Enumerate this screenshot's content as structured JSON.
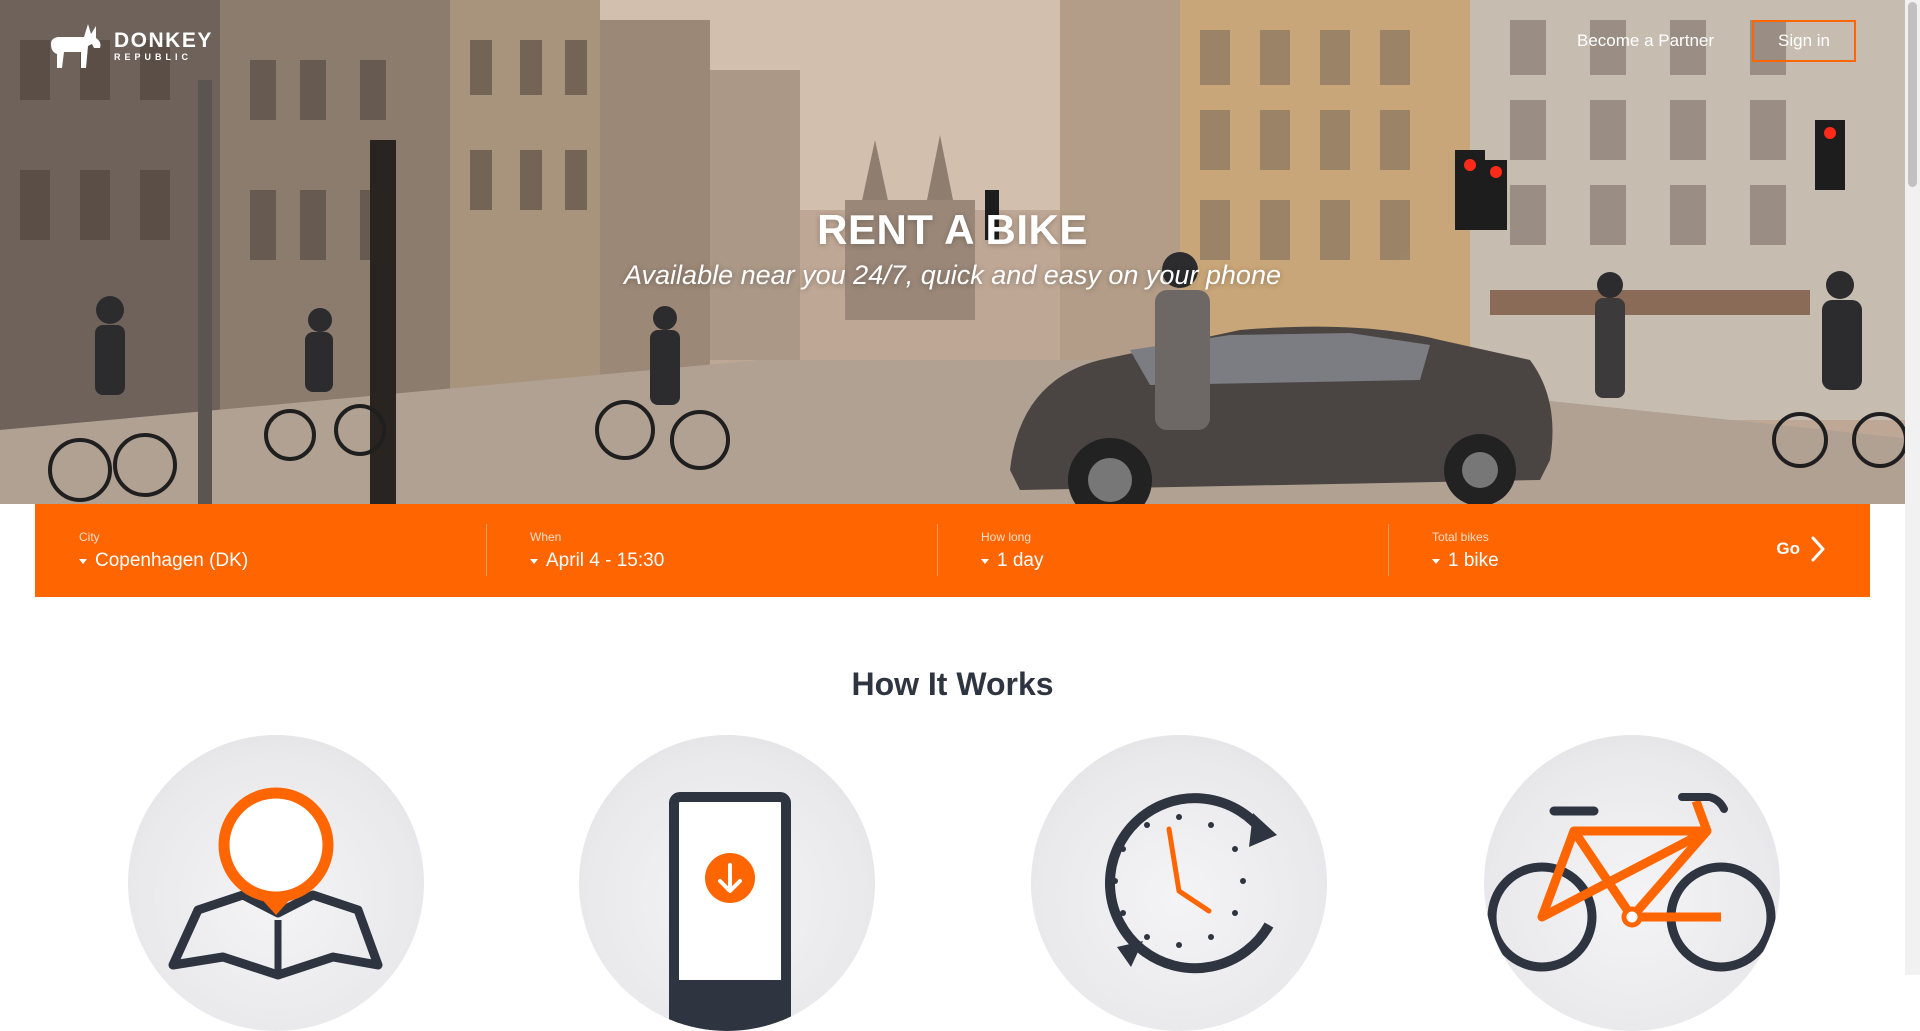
{
  "brand": {
    "name_line1": "DONKEY",
    "name_line2": "REPUBLIC"
  },
  "nav": {
    "partner_label": "Become a Partner",
    "signin_label": "Sign in"
  },
  "hero": {
    "title": "RENT A BIKE",
    "subtitle": "Available near you 24/7, quick and easy on your phone"
  },
  "search": {
    "city": {
      "label": "City",
      "value": "Copenhagen (DK)"
    },
    "when": {
      "label": "When",
      "value": "April 4 - 15:30"
    },
    "duration": {
      "label": "How long",
      "value": "1 day"
    },
    "bikes": {
      "label": "Total bikes",
      "value": "1 bike"
    },
    "go_label": "Go"
  },
  "how_it_works": {
    "title": "How It Works",
    "steps": [
      {
        "icon": "map-pin-icon"
      },
      {
        "icon": "phone-download-icon"
      },
      {
        "icon": "clock-icon"
      },
      {
        "icon": "bicycle-icon"
      }
    ]
  },
  "colors": {
    "accent": "#ff6602",
    "dark": "#2e3440"
  }
}
